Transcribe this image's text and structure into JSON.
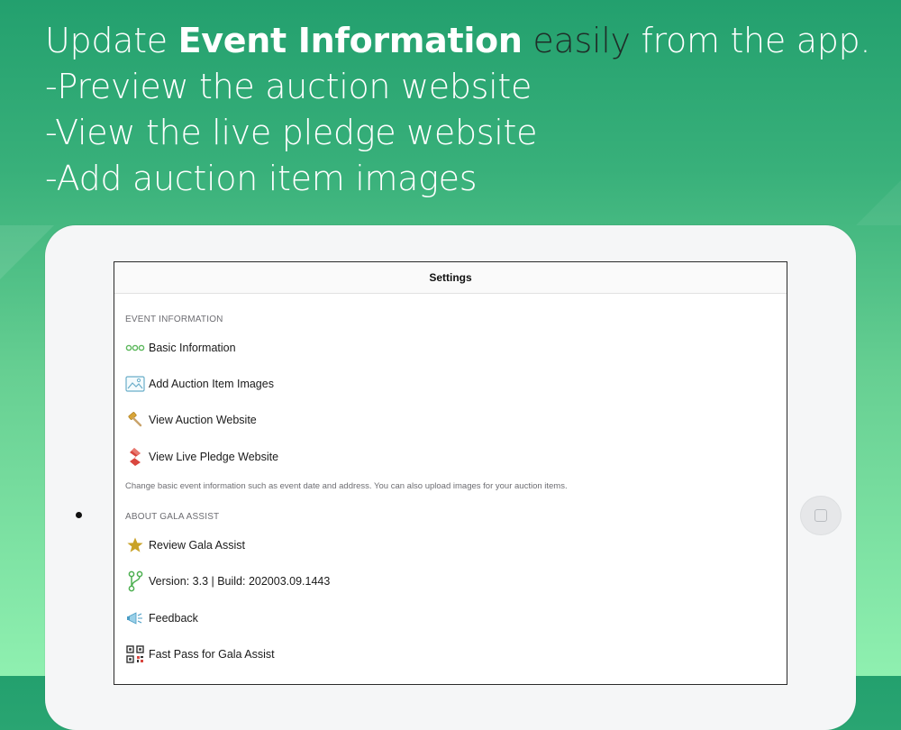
{
  "headline": {
    "line1_prefix": "Update ",
    "line1_bold": "Event Information",
    "line1_dark": " easily",
    "line1_suffix": "  from the app.",
    "line2": "-Preview the auction website",
    "line3": "-View the live pledge website",
    "line4": "-Add auction item images"
  },
  "settings": {
    "title": "Settings",
    "event_section": {
      "header": "EVENT INFORMATION",
      "items": [
        {
          "label": "Basic Information",
          "icon": "ellipsis-circles-icon"
        },
        {
          "label": "Add Auction Item Images",
          "icon": "image-icon"
        },
        {
          "label": "View Auction Website",
          "icon": "gavel-icon"
        },
        {
          "label": "View Live Pledge Website",
          "icon": "pledge-logo-icon"
        }
      ],
      "footer": "Change basic event information such as event date and address. You can also upload images for your auction items."
    },
    "about_section": {
      "header": "ABOUT GALA ASSIST",
      "items": [
        {
          "label": "Review Gala Assist",
          "icon": "star-icon"
        },
        {
          "label": "Version: 3.3 | Build: 202003.09.1443",
          "icon": "branch-icon"
        },
        {
          "label": "Feedback",
          "icon": "megaphone-icon"
        },
        {
          "label": "Fast Pass for Gala Assist",
          "icon": "qr-code-icon"
        }
      ]
    }
  },
  "colors": {
    "bg_top": "#23a06e",
    "bg_bottom": "#8ff0b0",
    "accent_green": "#5cb85c",
    "star_gold": "#c9a227",
    "pledge_red": "#d9473f"
  }
}
